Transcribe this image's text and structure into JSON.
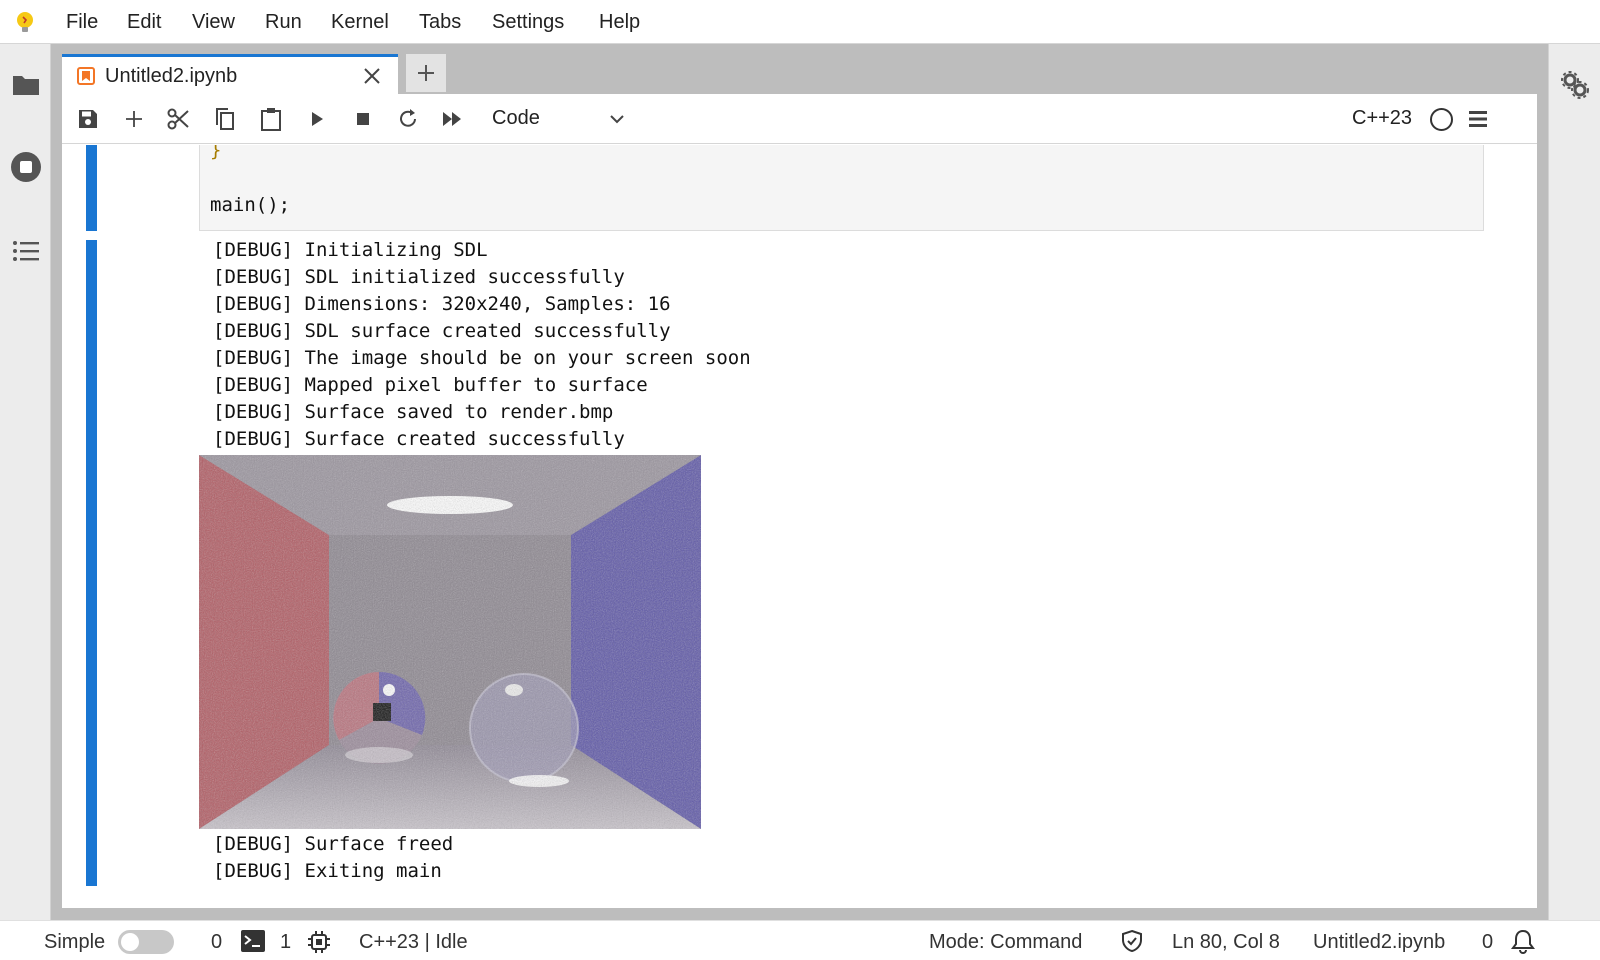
{
  "menu": {
    "items": [
      "File",
      "Edit",
      "View",
      "Run",
      "Kernel",
      "Tabs",
      "Settings",
      "Help"
    ]
  },
  "tabs": {
    "active_label": "Untitled2.ipynb",
    "add_label": "+"
  },
  "toolbar": {
    "cell_type": "Code",
    "kernel_name": "C++23",
    "kernel_status": "idle"
  },
  "cells": {
    "code_lines": [
      "}",
      "",
      "main();"
    ],
    "output_lines_before": [
      "[DEBUG] Initializing SDL",
      "[DEBUG] SDL initialized successfully",
      "[DEBUG] Dimensions: 320x240, Samples: 16",
      "[DEBUG] SDL surface created successfully",
      "[DEBUG] The image should be on your screen soon",
      "[DEBUG] Mapped pixel buffer to surface",
      "[DEBUG] Surface saved to render.bmp",
      "[DEBUG] Surface created successfully"
    ],
    "output_lines_after": [
      "[DEBUG] Surface freed",
      "[DEBUG] Exiting main"
    ]
  },
  "statusbar": {
    "mode_label": "Simple",
    "terminals_count": "0",
    "kernels_count": "1",
    "kernel_status": "C++23 | Idle",
    "mode": "Mode: Command",
    "cursor": "Ln 80, Col 8",
    "filename": "Untitled2.ipynb",
    "notifications": "0"
  },
  "colors": {
    "accent": "#1976d2",
    "tab_icon": "#f37626"
  }
}
